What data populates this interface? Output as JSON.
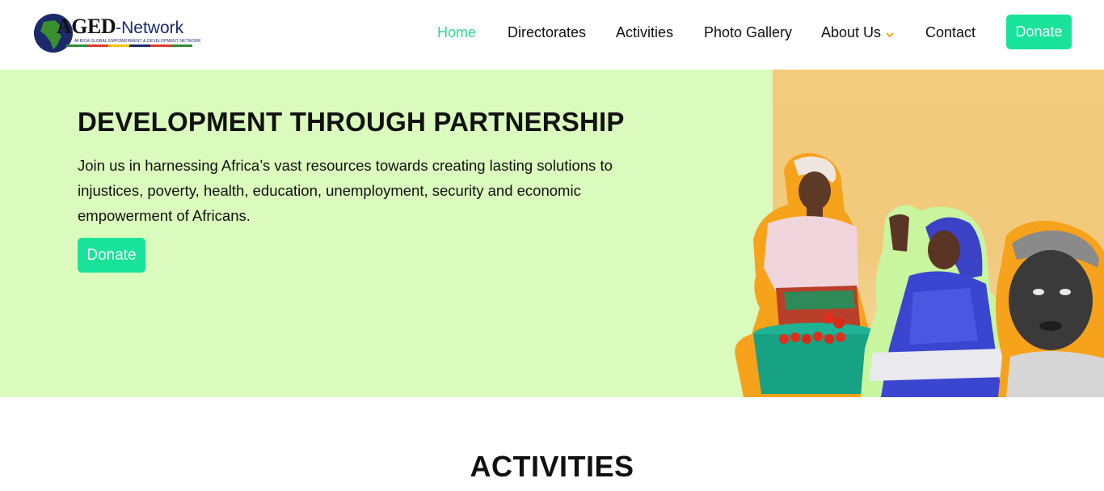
{
  "header": {
    "logo": {
      "brand_main": "AGED",
      "brand_suffix": "-Network",
      "tagline": "AFRICA GLOBAL EMPOWERMENT & DEVELOPMENT NETWORK",
      "stripe_colors": [
        "#2e8b3a",
        "#e03a2e",
        "#f5c400",
        "#1b2a6b",
        "#e03a2e",
        "#2e8b3a"
      ]
    },
    "nav": {
      "items": [
        {
          "label": "Home",
          "active": true
        },
        {
          "label": "Directorates"
        },
        {
          "label": "Activities"
        },
        {
          "label": "Photo Gallery"
        },
        {
          "label": "About Us",
          "has_dropdown": true
        },
        {
          "label": "Contact"
        }
      ],
      "donate_label": "Donate"
    }
  },
  "hero": {
    "title": "DEVELOPMENT THROUGH PARTNERSHIP",
    "text": "Join us in harnessing Africa’s vast resources towards creating lasting solutions to injustices, poverty, health, education, unemployment, security and economic empowerment of Africans.",
    "donate_label": "Donate"
  },
  "activities": {
    "title": "ACTIVITIES"
  },
  "colors": {
    "accent": "#19e39a",
    "nav_active": "#2fd895",
    "hero_bg": "#dafbbd",
    "hero_side_bg": "#f3cb7c",
    "chevron": "#f5a623"
  }
}
